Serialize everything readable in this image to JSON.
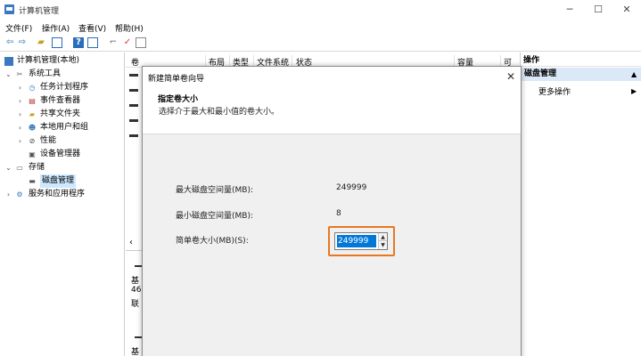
{
  "window": {
    "title": "计算机管理",
    "minimize": "─",
    "maximize": "☐",
    "close": "✕"
  },
  "menu": [
    "文件(F)",
    "操作(A)",
    "查看(V)",
    "帮助(H)"
  ],
  "tree": {
    "root": "计算机管理(本地)",
    "system_tools": "系统工具",
    "task_scheduler": "任务计划程序",
    "event_viewer": "事件查看器",
    "shared_folders": "共享文件夹",
    "local_users": "本地用户和组",
    "performance": "性能",
    "device_manager": "设备管理器",
    "storage": "存储",
    "disk_management": "磁盘管理",
    "services_apps": "服务和应用程序"
  },
  "columns": [
    "卷",
    "布局",
    "类型",
    "文件系统",
    "状态",
    "容量",
    "可"
  ],
  "left_fragments": {
    "scroll_arrow": "‹",
    "line1": "基",
    "line2": "46",
    "line3": "联",
    "line4": "基"
  },
  "actions": {
    "header": "操作",
    "section": "磁盘管理",
    "more": "更多操作"
  },
  "dialog": {
    "title": "新建简单卷向导",
    "close": "✕",
    "heading": "指定卷大小",
    "subheading": "选择介于最大和最小值的卷大小。",
    "max_label": "最大磁盘空间量(MB):",
    "max_value": "249999",
    "min_label": "最小磁盘空间量(MB):",
    "min_value": "8",
    "size_label": "简单卷大小(MB)(S):",
    "size_value": "249999"
  },
  "colors": {
    "highlight": "#e87722",
    "selection": "#0078d7",
    "tree_selected": "#cce8ff"
  }
}
